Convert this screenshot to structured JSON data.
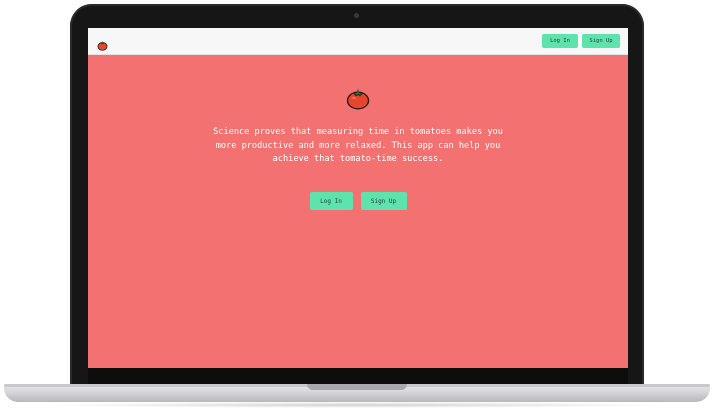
{
  "app": {
    "logo_icon": "tomato-icon",
    "brand_color": "#f47171",
    "accent_color": "#5fe3ad"
  },
  "navbar": {
    "login_label": "Log In",
    "signup_label": "Sign Up"
  },
  "hero": {
    "icon": "tomato-icon",
    "tagline": "Science proves that measuring time in tomatoes makes you more productive and more relaxed. This app can help you achieve that tomato-time success.",
    "login_label": "Log In",
    "signup_label": "Sign Up"
  }
}
